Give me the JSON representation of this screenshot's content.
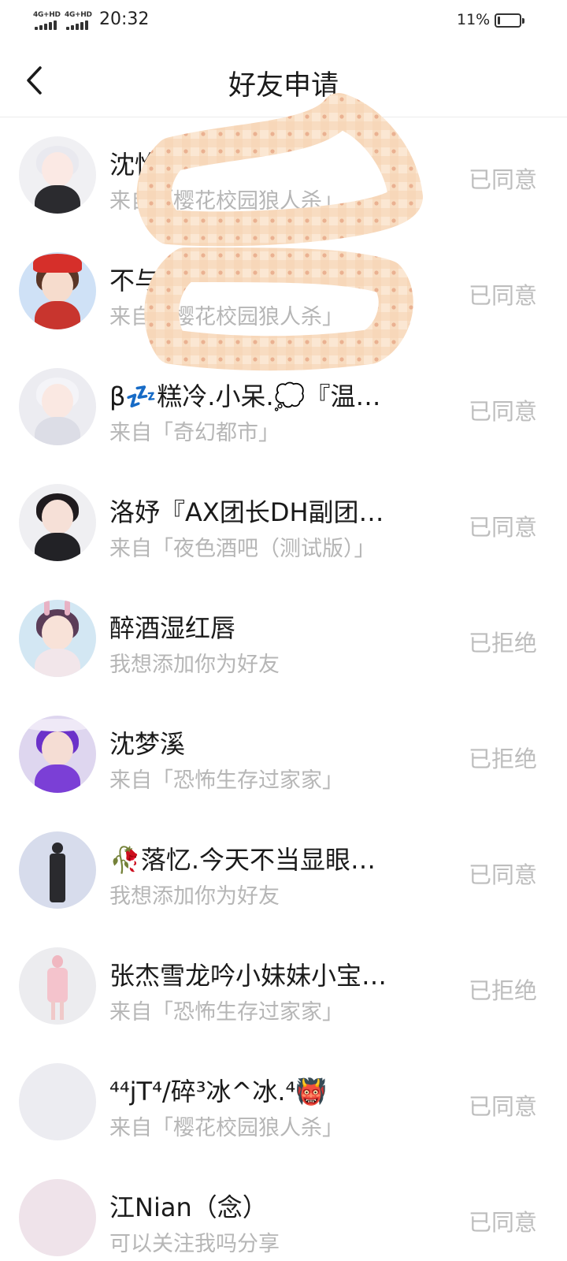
{
  "status_bar": {
    "network_1": "4G+HD",
    "network_2": "4G+HD",
    "time": "20:32",
    "battery_percent": "11%",
    "battery_level": 0.11
  },
  "nav": {
    "back_icon": "chevron-left-icon",
    "title": "好友申请"
  },
  "requests": [
    {
      "name": "沈怡",
      "source": "来自「樱花校园狼人杀」",
      "status": "已同意"
    },
    {
      "name": "不与情",
      "source": "来自「樱花校园狼人杀」",
      "status": "已同意"
    },
    {
      "name": "β💤糕冷.小呆.💭『温…",
      "source": "来自「奇幻都市」",
      "status": "已同意"
    },
    {
      "name": "洛妤『AX团长DH副团…",
      "source": "来自「夜色酒吧（测试版）」",
      "status": "已同意"
    },
    {
      "name": "醉酒湿红唇",
      "source": "我想添加你为好友",
      "status": "已拒绝"
    },
    {
      "name": "沈梦溪",
      "source": "来自「恐怖生存过家家」",
      "status": "已拒绝"
    },
    {
      "name": "🥀落忆.今天不当显眼…",
      "source": "我想添加你为好友",
      "status": "已同意"
    },
    {
      "name": "张杰雪龙吟小妹妹小宝…",
      "source": "来自「恐怖生存过家家」",
      "status": "已拒绝"
    },
    {
      "name": "⁴⁴jT⁴/碎³冰^冰.⁴👹",
      "source": "来自「樱花校园狼人杀」",
      "status": "已同意"
    },
    {
      "name": "江Nian（念）",
      "source": "可以关注我吗分享",
      "status": "已同意"
    }
  ],
  "colors": {
    "title_text": "#1a1a1a",
    "secondary_text": "#b6b6b6",
    "status_text": "#bdbdbd",
    "scribble": "#f6d7b8"
  }
}
